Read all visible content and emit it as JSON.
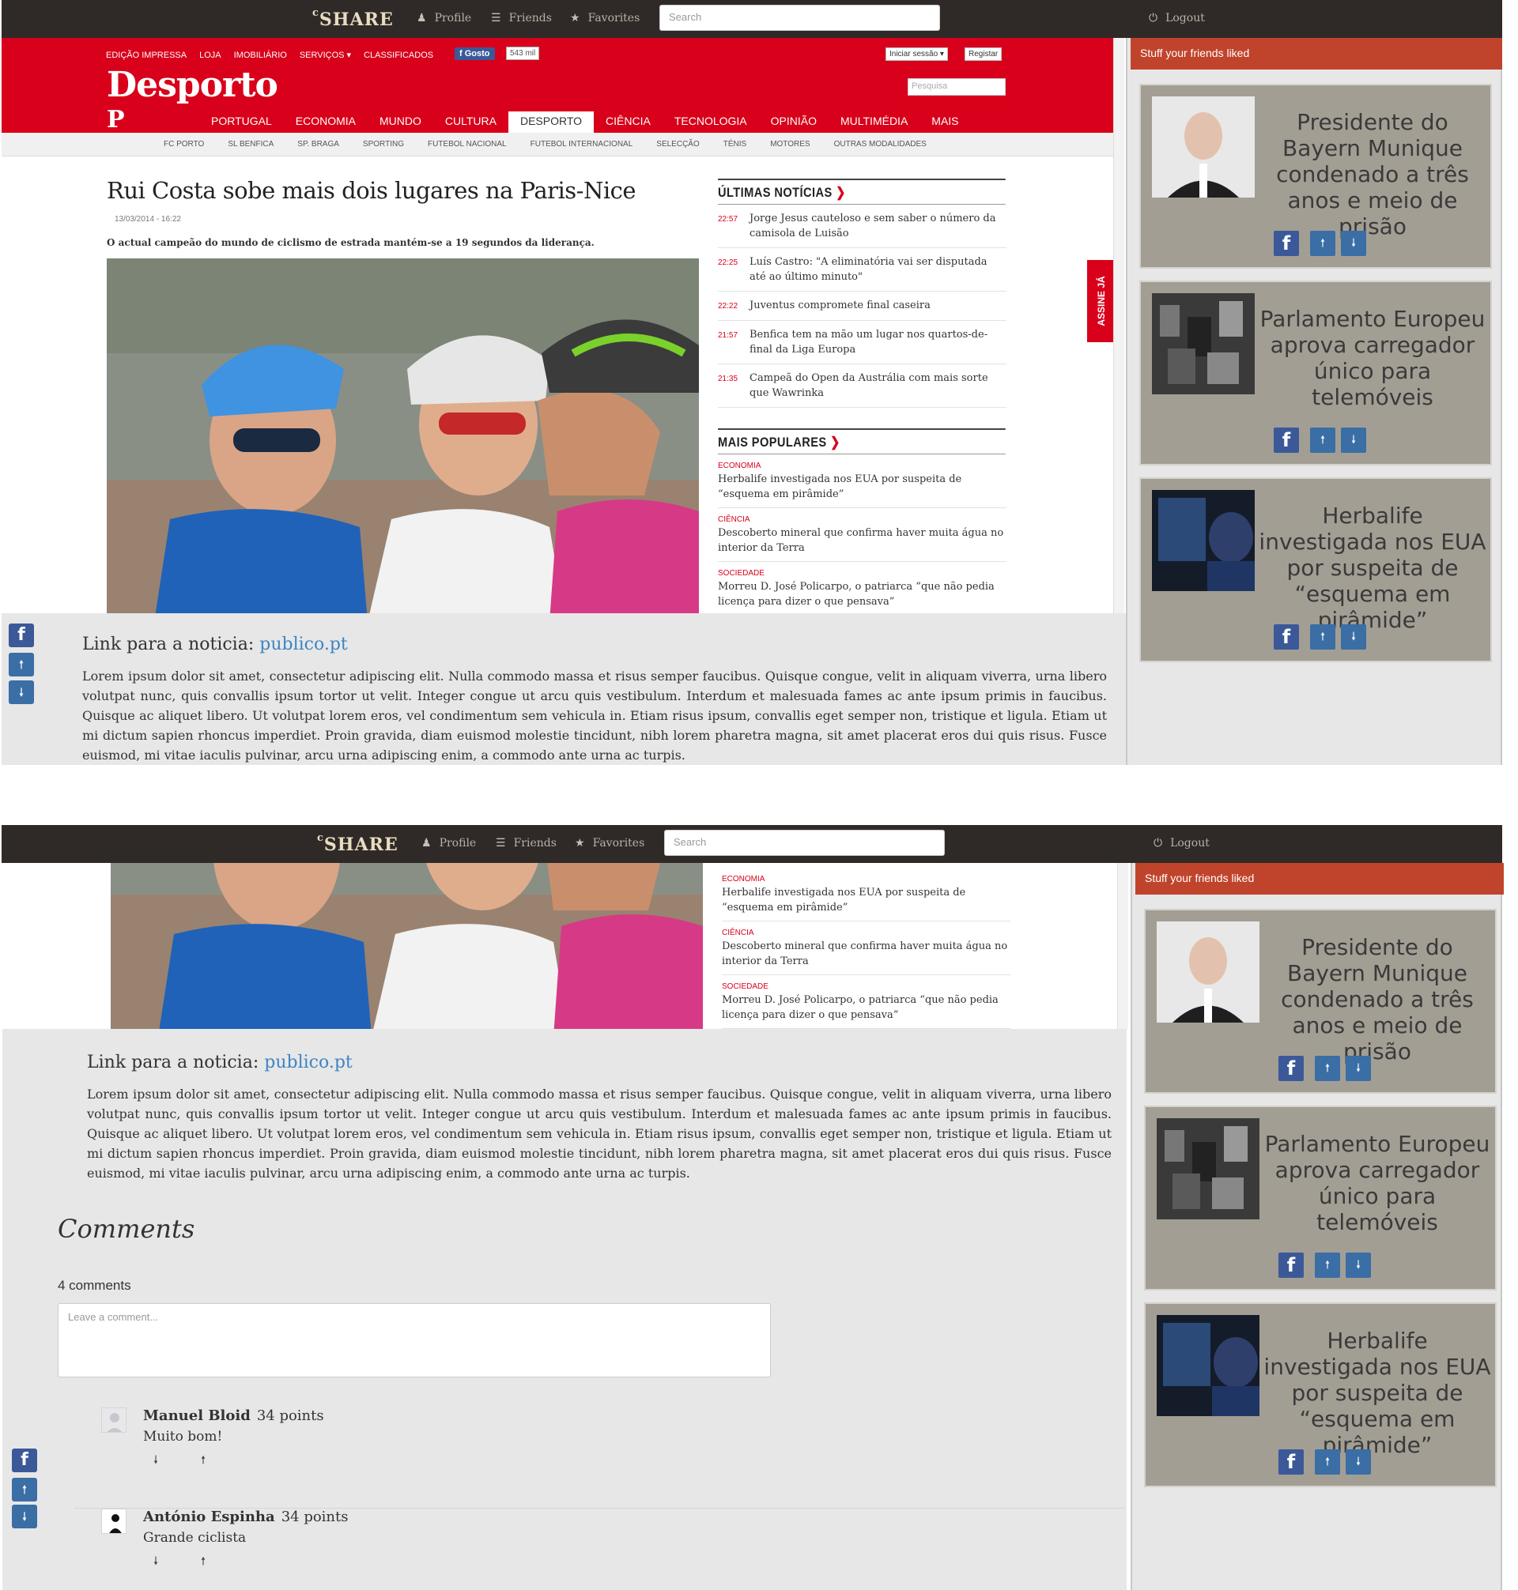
{
  "topbar": {
    "logo": "SHARE",
    "logo_prefix": "c",
    "profile": "Profile",
    "friends": "Friends",
    "favorites": "Favorites",
    "search_placeholder": "Search",
    "logout": "Logout"
  },
  "news_page": {
    "top_links": [
      "EDIÇÃO IMPRESSA",
      "LOJA",
      "IMOBILIÁRIO",
      "SERVIÇOS ▾",
      "CLASSIFICADOS"
    ],
    "fb_like": "Gosto",
    "fb_count": "543 mil",
    "login": "Iniciar sessão ▾",
    "register": "Registar",
    "search_placeholder": "Pesquisa",
    "brand": "Desporto",
    "brand_mark": "P",
    "menu": [
      "PORTUGAL",
      "ECONOMIA",
      "MUNDO",
      "CULTURA",
      "DESPORTO",
      "CIÊNCIA",
      "TECNOLOGIA",
      "OPINIÃO",
      "MULTIMÉDIA",
      "MAIS"
    ],
    "menu_active": "DESPORTO",
    "submenu": [
      "FC PORTO",
      "SL BENFICA",
      "SP. BRAGA",
      "SPORTING",
      "FUTEBOL NACIONAL",
      "FUTEBOL INTERNACIONAL",
      "SELECÇÃO",
      "TÉNIS",
      "MOTORES",
      "OUTRAS MODALIDADES"
    ],
    "article_title": "Rui Costa sobe mais dois lugares na Paris-Nice",
    "article_date": "13/03/2014 - 16:22",
    "article_lead": "O actual campeão do mundo de ciclismo de estrada mantém-se a 19 segundos da liderança.",
    "latest_heading": "ÚLTIMAS NOTÍCIAS",
    "latest": [
      {
        "time": "22:57",
        "text": "Jorge Jesus cauteloso e sem saber o número da camisola de Luisão"
      },
      {
        "time": "22:25",
        "text": "Luís Castro: \"A eliminatória vai ser disputada até ao último minuto\""
      },
      {
        "time": "22:22",
        "text": "Juventus compromete final caseira"
      },
      {
        "time": "21:57",
        "text": "Benfica tem na mão um lugar nos quartos-de-final da Liga Europa"
      },
      {
        "time": "21:35",
        "text": "Campeã do Open da Austrália com mais sorte que Wawrinka"
      }
    ],
    "popular_heading": "MAIS POPULARES",
    "popular": [
      {
        "category": "ECONOMIA",
        "text": "Herbalife investigada nos EUA por suspeita de “esquema em pirâmide”"
      },
      {
        "category": "CIÊNCIA",
        "text": "Descoberto mineral que confirma haver muita água no interior da Terra"
      },
      {
        "category": "SOCIEDADE",
        "text": "Morreu D. José Policarpo, o patriarca “que não pedia licença para dizer o que pensava”"
      }
    ],
    "assine": "ASSINE JÁ"
  },
  "post": {
    "link_label": "Link para a noticia:",
    "link_text": "publico.pt",
    "body": "Lorem ipsum dolor sit amet, consectetur adipiscing elit. Nulla commodo massa et risus semper faucibus. Quisque congue, velit in aliquam viverra, urna libero volutpat nunc, quis convallis ipsum tortor ut velit. Integer congue ut arcu quis vestibulum. Interdum et malesuada fames ac ante ipsum primis in faucibus. Quisque ac aliquet libero. Ut volutpat lorem eros, vel condimentum sem vehicula in. Etiam risus ipsum, convallis eget semper non, tristique et ligula. Etiam ut mi dictum sapien rhoncus imperdiet. Proin gravida, diam euismod molestie tincidunt, nibh lorem pharetra magna, sit amet placerat eros dui quis risus. Fusce euismod, mi vitae iaculis pulvinar, arcu urna adipiscing enim, a commodo ante urna ac turpis."
  },
  "sidebar": {
    "heading": "Stuff your friends liked",
    "cards": [
      {
        "title": "Presidente do Bayern Munique condenado a três anos e meio de prisão"
      },
      {
        "title": "Parlamento Europeu aprova carregador único para telemóveis"
      },
      {
        "title": "Herbalife investigada nos EUA por suspeita de “esquema em pirâmide”"
      }
    ]
  },
  "comments": {
    "heading": "Comments",
    "count": "4 comments",
    "placeholder": "Leave a comment...",
    "items": [
      {
        "author": "Manuel Bloid",
        "points": "34 points",
        "text": "Muito bom!"
      },
      {
        "author": "António Espinha",
        "points": "34 points",
        "text": "Grande ciclista"
      }
    ]
  },
  "icons": {
    "facebook": "facebook-icon",
    "upvote": "arrow-up-icon",
    "downvote": "arrow-down-icon",
    "user": "user-icon",
    "list": "list-icon",
    "star": "star-icon",
    "power": "power-icon"
  },
  "colors": {
    "topbar": "#2f2a28",
    "news_red": "#d8001a",
    "sidebar_header": "#c0442c",
    "card": "#a39e94",
    "link": "#3f84c4",
    "facebook": "#3b5998"
  }
}
